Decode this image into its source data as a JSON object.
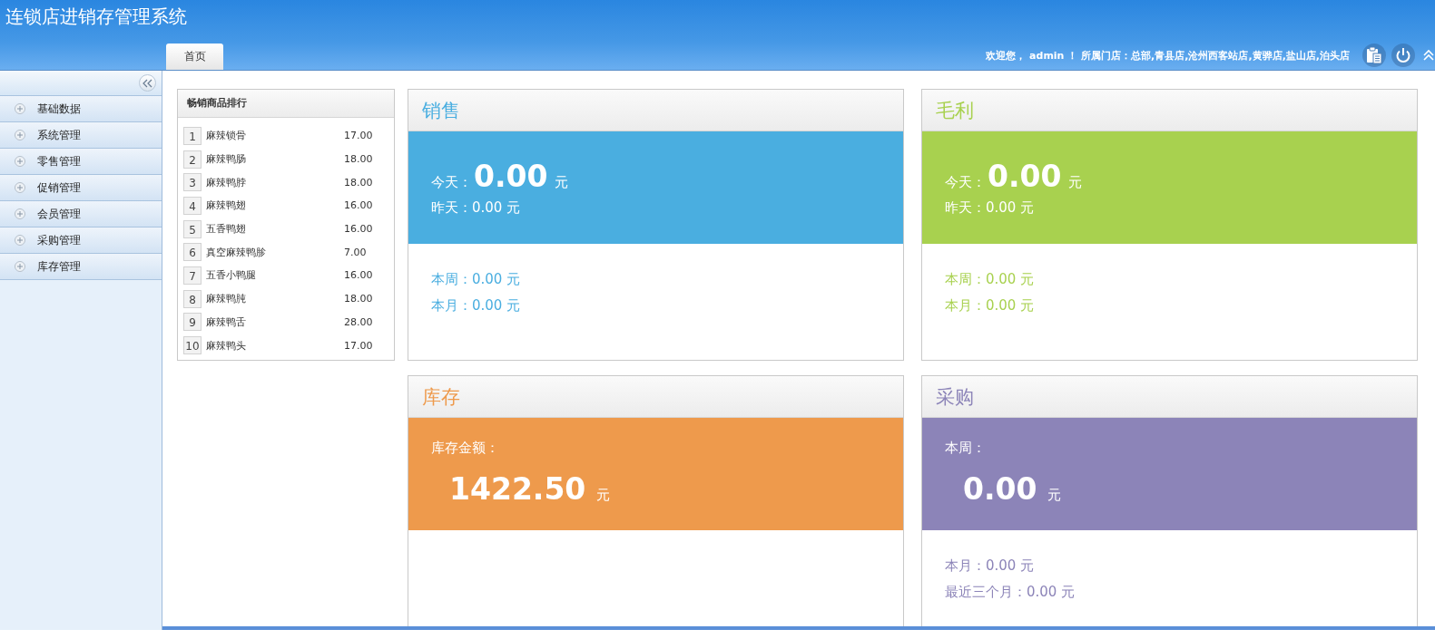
{
  "app_title": "连锁店进销存管理系统",
  "tabs": [
    {
      "label": "首页",
      "selected": true
    }
  ],
  "welcome": "欢迎您， admin ！ 所属门店：总部,青县店,沧州西客站店,黄骅店,盐山店,泊头店",
  "sidebar": {
    "items": [
      {
        "label": "基础数据",
        "expanded": false
      },
      {
        "label": "系统管理",
        "expanded": false
      },
      {
        "label": "零售管理",
        "expanded": false
      },
      {
        "label": "促销管理",
        "expanded": false
      },
      {
        "label": "会员管理",
        "expanded": false
      },
      {
        "label": "采购管理",
        "expanded": false
      },
      {
        "label": "库存管理",
        "expanded": false
      }
    ]
  },
  "ranking": {
    "title": "畅销商品排行",
    "rows": [
      {
        "rank": "1",
        "name": "麻辣锁骨",
        "price": "17.00"
      },
      {
        "rank": "2",
        "name": "麻辣鸭肠",
        "price": "18.00"
      },
      {
        "rank": "3",
        "name": "麻辣鸭脖",
        "price": "18.00"
      },
      {
        "rank": "4",
        "name": "麻辣鸭翅",
        "price": "16.00"
      },
      {
        "rank": "5",
        "name": "五香鸭翅",
        "price": "16.00"
      },
      {
        "rank": "6",
        "name": "真空麻辣鸭胗",
        "price": "7.00"
      },
      {
        "rank": "7",
        "name": "五香小鸭腿",
        "price": "16.00"
      },
      {
        "rank": "8",
        "name": "麻辣鸭肫",
        "price": "18.00"
      },
      {
        "rank": "9",
        "name": "麻辣鸭舌",
        "price": "28.00"
      },
      {
        "rank": "10",
        "name": "麻辣鸭头",
        "price": "17.00"
      }
    ]
  },
  "cards": [
    {
      "title": "销售",
      "color": "#4aaee0",
      "band": [
        {
          "kind": "big_inline",
          "label": "今天：",
          "value": "0.00",
          "unit": "元"
        },
        {
          "kind": "text",
          "text": "昨天：0.00 元"
        }
      ],
      "footer": [
        "本周：0.00 元",
        "本月：0.00 元"
      ]
    },
    {
      "title": "毛利",
      "color": "#a8d14f",
      "band": [
        {
          "kind": "big_inline",
          "label": "今天：",
          "value": "0.00",
          "unit": "元"
        },
        {
          "kind": "text",
          "text": "昨天：0.00 元"
        }
      ],
      "footer": [
        "本周：0.00 元",
        "本月：0.00 元"
      ]
    },
    {
      "title": "库存",
      "color": "#ee9a4c",
      "band": [
        {
          "kind": "label",
          "text": "库存金额："
        },
        {
          "kind": "big_value",
          "value": "1422.50",
          "unit": "元"
        }
      ]
    },
    {
      "title": "采购",
      "color": "#8c84b8",
      "band": [
        {
          "kind": "label",
          "text": "本周："
        },
        {
          "kind": "big_value",
          "value": "0.00",
          "unit": "元"
        }
      ],
      "footer": [
        "本月：0.00 元",
        "最近三个月：0.00 元"
      ]
    }
  ]
}
